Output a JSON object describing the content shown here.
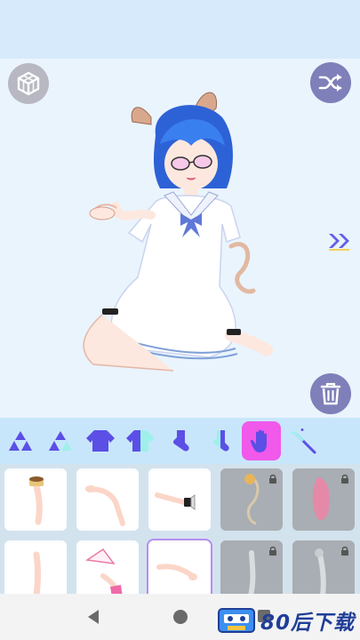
{
  "colors": {
    "background": "#eaf4fd",
    "top_band": "#d7eafb",
    "toolbar": "#c8e6fb",
    "active_tool": "#f059ea",
    "button_purple": "#7f7fb9",
    "button_grey": "#b8b8c2",
    "tool_icon": "#5b4fe6",
    "locked_tile": "#a8aeb3",
    "watermark_text": "#1f3e98"
  },
  "top_controls": {
    "left_icon": "cube-3d-icon",
    "right_icon": "shuffle-icon"
  },
  "side_controls": {
    "next_icon": "double-chevron-right-icon",
    "delete_icon": "trash-icon"
  },
  "toolbar": {
    "tools": [
      {
        "name": "triangles-solid-icon",
        "active": false
      },
      {
        "name": "triangles-outline-icon",
        "active": false
      },
      {
        "name": "top-solid-icon",
        "active": false
      },
      {
        "name": "top-split-icon",
        "active": false
      },
      {
        "name": "sock-solid-icon",
        "active": false
      },
      {
        "name": "sock-split-icon",
        "active": false
      },
      {
        "name": "hand-icon",
        "active": true
      },
      {
        "name": "magic-wand-icon",
        "active": false
      }
    ]
  },
  "items": [
    {
      "name": "arm-with-cup",
      "locked": false,
      "selected": false
    },
    {
      "name": "arm-open-hand",
      "locked": false,
      "selected": false
    },
    {
      "name": "arm-frill-cuff",
      "locked": false,
      "selected": false
    },
    {
      "name": "arm-cat-toy",
      "locked": true,
      "selected": false
    },
    {
      "name": "arm-pink-glove",
      "locked": true,
      "selected": false
    },
    {
      "name": "arm-plain",
      "locked": false,
      "selected": false
    },
    {
      "name": "arm-fan",
      "locked": false,
      "selected": false
    },
    {
      "name": "arm-pointing",
      "locked": false,
      "selected": true
    },
    {
      "name": "arm-grey-sketch",
      "locked": true,
      "selected": false
    },
    {
      "name": "arm-grey-holding",
      "locked": true,
      "selected": false
    }
  ],
  "watermark": {
    "text": "80后下载"
  },
  "nav": {
    "back": "back-triangle-icon",
    "home": "home-circle-icon",
    "recent": "recent-square-icon"
  }
}
